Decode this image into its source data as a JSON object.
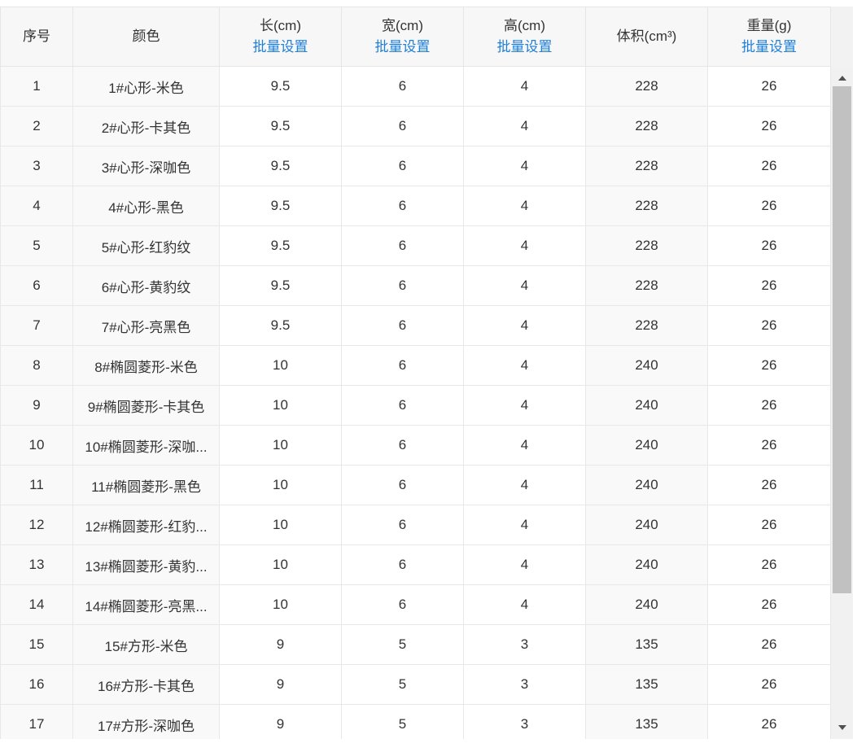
{
  "header": {
    "seq": "序号",
    "color": "颜色",
    "length": "长(cm)",
    "width": "宽(cm)",
    "height": "高(cm)",
    "volume": "体积(cm³)",
    "weight": "重量(g)",
    "batch_length": "批量设置",
    "batch_width": "批量设置",
    "batch_height": "批量设置",
    "batch_weight": "批量设置"
  },
  "rows": [
    {
      "seq": "1",
      "color": "1#心形-米色",
      "length": "9.5",
      "width": "6",
      "height": "4",
      "volume": "228",
      "weight": "26"
    },
    {
      "seq": "2",
      "color": "2#心形-卡其色",
      "length": "9.5",
      "width": "6",
      "height": "4",
      "volume": "228",
      "weight": "26"
    },
    {
      "seq": "3",
      "color": "3#心形-深咖色",
      "length": "9.5",
      "width": "6",
      "height": "4",
      "volume": "228",
      "weight": "26"
    },
    {
      "seq": "4",
      "color": "4#心形-黑色",
      "length": "9.5",
      "width": "6",
      "height": "4",
      "volume": "228",
      "weight": "26"
    },
    {
      "seq": "5",
      "color": "5#心形-红豹纹",
      "length": "9.5",
      "width": "6",
      "height": "4",
      "volume": "228",
      "weight": "26"
    },
    {
      "seq": "6",
      "color": "6#心形-黄豹纹",
      "length": "9.5",
      "width": "6",
      "height": "4",
      "volume": "228",
      "weight": "26"
    },
    {
      "seq": "7",
      "color": "7#心形-亮黑色",
      "length": "9.5",
      "width": "6",
      "height": "4",
      "volume": "228",
      "weight": "26"
    },
    {
      "seq": "8",
      "color": "8#椭圆菱形-米色",
      "length": "10",
      "width": "6",
      "height": "4",
      "volume": "240",
      "weight": "26"
    },
    {
      "seq": "9",
      "color": "9#椭圆菱形-卡其色",
      "length": "10",
      "width": "6",
      "height": "4",
      "volume": "240",
      "weight": "26"
    },
    {
      "seq": "10",
      "color": "10#椭圆菱形-深咖...",
      "length": "10",
      "width": "6",
      "height": "4",
      "volume": "240",
      "weight": "26"
    },
    {
      "seq": "11",
      "color": "11#椭圆菱形-黑色",
      "length": "10",
      "width": "6",
      "height": "4",
      "volume": "240",
      "weight": "26"
    },
    {
      "seq": "12",
      "color": "12#椭圆菱形-红豹...",
      "length": "10",
      "width": "6",
      "height": "4",
      "volume": "240",
      "weight": "26"
    },
    {
      "seq": "13",
      "color": "13#椭圆菱形-黄豹...",
      "length": "10",
      "width": "6",
      "height": "4",
      "volume": "240",
      "weight": "26"
    },
    {
      "seq": "14",
      "color": "14#椭圆菱形-亮黑...",
      "length": "10",
      "width": "6",
      "height": "4",
      "volume": "240",
      "weight": "26"
    },
    {
      "seq": "15",
      "color": "15#方形-米色",
      "length": "9",
      "width": "5",
      "height": "3",
      "volume": "135",
      "weight": "26"
    },
    {
      "seq": "16",
      "color": "16#方形-卡其色",
      "length": "9",
      "width": "5",
      "height": "3",
      "volume": "135",
      "weight": "26"
    },
    {
      "seq": "17",
      "color": "17#方形-深咖色",
      "length": "9",
      "width": "5",
      "height": "3",
      "volume": "135",
      "weight": "26"
    }
  ],
  "colors": {
    "link": "#1e7fd8",
    "header_bg": "#f7f7f7",
    "readonly_cell_bg": "#f9f9f9",
    "border": "#e6e6e6",
    "scrollbar_thumb": "#c1c1c1"
  }
}
